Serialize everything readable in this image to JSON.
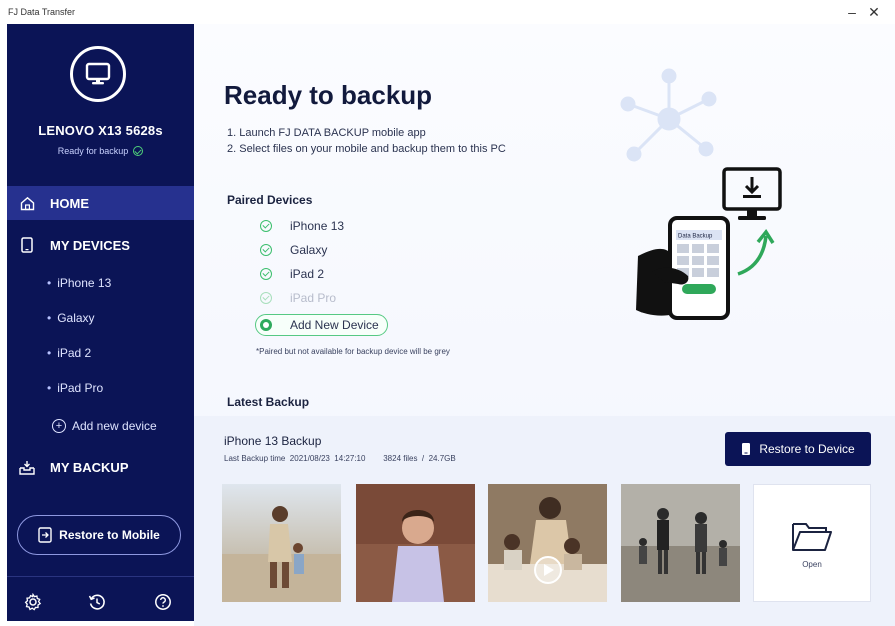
{
  "window": {
    "title": "FJ Data Transfer",
    "minimize": "–",
    "close": "✕"
  },
  "sidebar": {
    "device_name": "LENOVO X13 5628s",
    "device_status": "Ready for backup",
    "nav": [
      {
        "label": "HOME",
        "icon": "home-icon",
        "active": true
      },
      {
        "label": "MY DEVICES",
        "icon": "phone-icon",
        "active": false
      },
      {
        "label": "MY BACKUP",
        "icon": "backup-tray-icon",
        "active": false
      }
    ],
    "devices": [
      {
        "label": "iPhone 13"
      },
      {
        "label": "Galaxy"
      },
      {
        "label": "iPad 2"
      },
      {
        "label": "iPad Pro"
      }
    ],
    "add_device_label": "Add new device",
    "restore_button": "Restore to Mobile",
    "bottom_icons": [
      "settings-icon",
      "history-icon",
      "help-icon"
    ]
  },
  "main": {
    "title": "Ready to backup",
    "steps": [
      "1. Launch FJ DATA BACKUP mobile app",
      "2. Select files on your mobile and backup them to this PC"
    ],
    "paired_title": "Paired Devices",
    "paired": [
      {
        "label": "iPhone 13",
        "available": true
      },
      {
        "label": "Galaxy",
        "available": true
      },
      {
        "label": "iPad 2",
        "available": true
      },
      {
        "label": "iPad Pro",
        "available": false
      }
    ],
    "add_new_label": "Add New Device",
    "note": "*Paired but not available for backup device will be grey",
    "illustration_phone_title": "Data Backup",
    "latest_title": "Latest Backup",
    "backup_name": "iPhone 13  Backup",
    "backup_meta": "Last Backup time  2021/08/23  14:27:10        3824 files  /  24.7GB",
    "restore_device_label": "Restore to Device",
    "open_label": "Open"
  },
  "colors": {
    "sidebar": "#0b1456",
    "sidebar_active": "#26318f",
    "accent_green": "#3cbf6d",
    "button_navy": "#0b1456"
  }
}
